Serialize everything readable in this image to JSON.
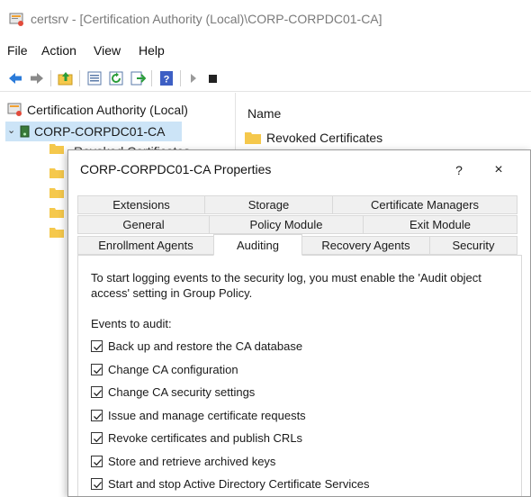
{
  "window": {
    "title": "certsrv - [Certification Authority (Local)\\CORP-CORPDC01-CA]"
  },
  "menu": [
    "File",
    "Action",
    "View",
    "Help"
  ],
  "toolbar": {
    "icons": [
      "back-icon",
      "forward-icon",
      "up-folder-icon",
      "properties-icon",
      "refresh-icon",
      "export-icon",
      "help-icon",
      "start-service-icon",
      "stop-service-icon"
    ]
  },
  "tree": {
    "root_label": "Certification Authority (Local)",
    "ca_label": "CORP-CORPDC01-CA",
    "partial_child": "Revoked Certificates"
  },
  "list": {
    "column_name": "Name",
    "rows": [
      "Revoked Certificates"
    ]
  },
  "dialog": {
    "title": "CORP-CORPDC01-CA Properties",
    "help": "?",
    "close": "×",
    "tabs_row1": [
      "Extensions",
      "Storage",
      "Certificate Managers"
    ],
    "tabs_row2": [
      "General",
      "Policy Module",
      "Exit Module"
    ],
    "tabs_row3": [
      "Enrollment Agents",
      "Auditing",
      "Recovery Agents",
      "Security"
    ],
    "active_tab": "Auditing",
    "intro": "To start logging events to the security log, you must enable the 'Audit object access' setting in Group Policy.",
    "events_label": "Events to audit:",
    "events": [
      {
        "label": "Back up and restore the CA database",
        "checked": true
      },
      {
        "label": "Change CA configuration",
        "checked": true
      },
      {
        "label": "Change CA security settings",
        "checked": true
      },
      {
        "label": "Issue and manage certificate requests",
        "checked": true
      },
      {
        "label": "Revoke certificates and publish CRLs",
        "checked": true
      },
      {
        "label": "Store and retrieve archived keys",
        "checked": true
      },
      {
        "label": "Start and stop Active Directory Certificate Services",
        "checked": true
      }
    ]
  },
  "colors": {
    "selection": "#cce4f7",
    "folder": "#f5c84c",
    "nav_arrow": "#2b7bd9"
  }
}
